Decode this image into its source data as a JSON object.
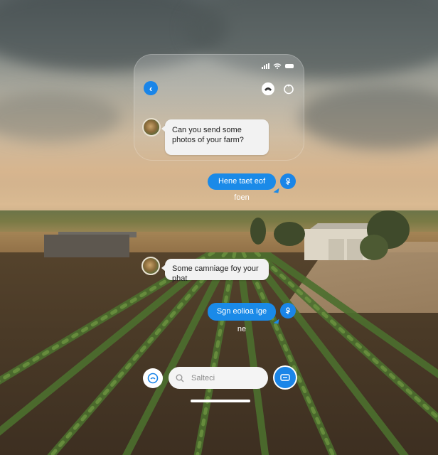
{
  "status_bar": {
    "signal_icon": "signal-bars-icon",
    "wifi_icon": "wifi-icon",
    "battery_icon": "battery-icon"
  },
  "header": {
    "back_icon_glyph": "‹",
    "back_icon": "chevron-left-icon",
    "call_icon": "phone-icon",
    "menu_icon": "circle-icon"
  },
  "messages": [
    {
      "direction": "incoming",
      "text": "Can you send some photos of your farm?"
    },
    {
      "direction": "outgoing",
      "text": "Hene taet eof foen"
    },
    {
      "direction": "incoming",
      "text": "Some camniage foy your phat"
    },
    {
      "direction": "outgoing",
      "text": "Sgn eolioa Ige ne"
    }
  ],
  "composer": {
    "placeholder": "Salteci",
    "emoji_icon": "emoji-icon",
    "search_icon": "search-icon",
    "send_icon": "send-icon"
  },
  "colors": {
    "accent": "#1a85e8",
    "bubble_incoming": "#f2f2f2",
    "bubble_outgoing": "#1a8ae8"
  }
}
